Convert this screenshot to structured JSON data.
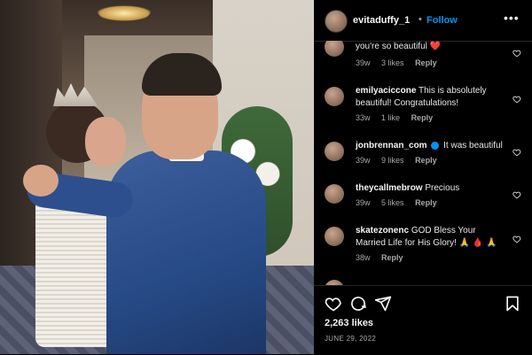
{
  "post": {
    "username": "evitaduffy_1",
    "separator": "•",
    "follow_label": "Follow",
    "more_label": "•••"
  },
  "comments": [
    {
      "user": "",
      "text": "you're so beautiful",
      "emoji": "❤️",
      "age": "39w",
      "likes": "3 likes",
      "reply": "Reply"
    },
    {
      "user": "emilyaciccone",
      "text": "This is absolutely beautiful! Congratulations!",
      "emoji": "",
      "age": "33w",
      "likes": "1 like",
      "reply": "Reply"
    },
    {
      "user": "jonbrennan_com",
      "text": "It was beautiful",
      "emoji": "",
      "age": "39w",
      "likes": "9 likes",
      "reply": "Reply",
      "verified": true
    },
    {
      "user": "theycallmebrow",
      "text": "Precious",
      "emoji": "",
      "age": "39w",
      "likes": "5 likes",
      "reply": "Reply"
    },
    {
      "user": "skatezonenc",
      "text": "GOD Bless Your Married Life for His Glory!",
      "emoji": "🙏 🩸 🙏",
      "age": "38w",
      "likes": "",
      "reply": "Reply"
    }
  ],
  "footer": {
    "likes": "2,263 likes",
    "date": "JUNE 29, 2022"
  },
  "colors": {
    "accent": "#0095f6",
    "heart": "#ed4956",
    "panel_bg": "#000000"
  },
  "icons": [
    "heart-icon",
    "comment-icon",
    "share-icon",
    "bookmark-icon",
    "more-icon",
    "verified-icon"
  ]
}
